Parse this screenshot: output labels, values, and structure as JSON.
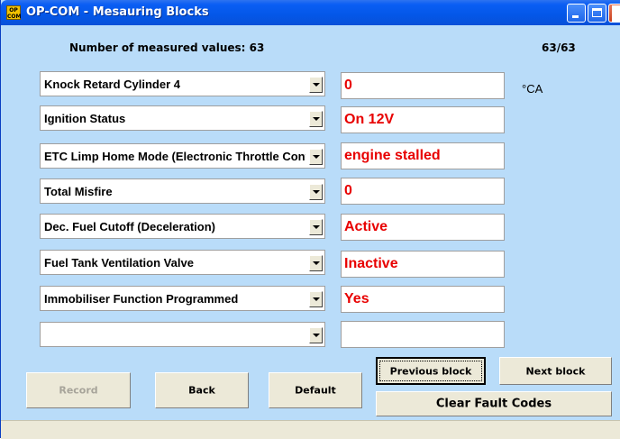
{
  "window": {
    "title": "OP-COM - Mesauring Blocks",
    "app_icon_text": "OP\nCOM",
    "title_bar_color": "#0457e8",
    "background_color": "#b9dcf9"
  },
  "header": {
    "measured_count_label": "Number of measured values: 63",
    "position_label": "63/63"
  },
  "rows": [
    {
      "parameter": "Knock Retard Cylinder 4",
      "value": "0",
      "unit": "°CA"
    },
    {
      "parameter": "Ignition Status",
      "value": "On  12V",
      "unit": ""
    },
    {
      "parameter": "ETC Limp Home Mode (Electronic Throttle Control)",
      "value": "engine stalled",
      "unit": ""
    },
    {
      "parameter": "Total Misfire",
      "value": "0",
      "unit": ""
    },
    {
      "parameter": "Dec. Fuel Cutoff (Deceleration)",
      "value": "Active",
      "unit": ""
    },
    {
      "parameter": "Fuel Tank Ventilation Valve",
      "value": "Inactive",
      "unit": ""
    },
    {
      "parameter": "Immobiliser Function Programmed",
      "value": "Yes",
      "unit": ""
    },
    {
      "parameter": "",
      "value": "",
      "unit": ""
    }
  ],
  "value_color": "#e80000",
  "buttons": {
    "record": "Record",
    "back": "Back",
    "default": "Default",
    "previous_block": "Previous block",
    "next_block": "Next block",
    "clear_fault_codes": "Clear Fault Codes"
  }
}
